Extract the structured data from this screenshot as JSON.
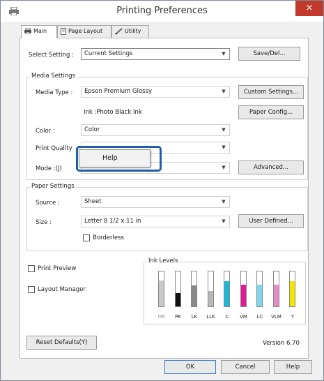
{
  "window": {
    "title": "Printing Preferences",
    "close_glyph": "×"
  },
  "tabs": [
    {
      "label": "Main",
      "icon": "printer-icon"
    },
    {
      "label": "Page Layout",
      "icon": "page-icon"
    },
    {
      "label": "Utility",
      "icon": "pencil-icon"
    }
  ],
  "select_setting": {
    "label": "Select Setting :",
    "value": "Current Settings",
    "button": "Save/Del..."
  },
  "media_settings": {
    "title": "Media Settings",
    "media_type_label": "Media Type :",
    "media_type_value": "Epson Premium Glossy",
    "custom_settings_button": "Custom Settings...",
    "ink_text": "Ink :Photo Black Ink",
    "paper_config_button": "Paper Config...",
    "color_label": "Color :",
    "color_value": "Color",
    "print_quality_label": "Print Quality",
    "print_quality_value": "",
    "mode_label": "Mode :(J)",
    "mode_value": "",
    "advanced_button": "Advanced..."
  },
  "context_menu": {
    "item": "Help"
  },
  "paper_settings": {
    "title": "Paper Settings",
    "source_label": "Source :",
    "source_value": "Sheet",
    "size_label": "Size :",
    "size_value": "Letter 8 1/2 x 11 in",
    "user_defined_button": "User Defined...",
    "borderless_label": "Borderless",
    "borderless_checked": false
  },
  "print_preview": {
    "label": "Print Preview",
    "checked": false
  },
  "layout_manager": {
    "label": "Layout Manager",
    "checked": false
  },
  "ink_levels": {
    "title": "Ink Levels",
    "inks": [
      {
        "name": "MK",
        "color": "#c8c8c8",
        "level": 0.75,
        "dim": true
      },
      {
        "name": "PK",
        "color": "#111111",
        "level": 0.38,
        "dim": false
      },
      {
        "name": "LK",
        "color": "#8a8a8a",
        "level": 0.6,
        "dim": false
      },
      {
        "name": "LLK",
        "color": "#b8b8b8",
        "level": 0.45,
        "dim": false
      },
      {
        "name": "C",
        "color": "#19b8d6",
        "level": 0.72,
        "dim": false
      },
      {
        "name": "VM",
        "color": "#e0199a",
        "level": 0.62,
        "dim": false
      },
      {
        "name": "LC",
        "color": "#7fd6ef",
        "level": 0.62,
        "dim": false
      },
      {
        "name": "VLM",
        "color": "#e88ac8",
        "level": 0.62,
        "dim": false
      },
      {
        "name": "Y",
        "color": "#f2e600",
        "level": 0.72,
        "dim": false
      }
    ]
  },
  "footer": {
    "reset_button": "Reset Defaults(Y)",
    "version": "Version 6.70",
    "ok_button": "OK",
    "cancel_button": "Cancel",
    "help_button": "Help"
  },
  "colors": {
    "accent": "#1f5fa7",
    "close": "#c0392b"
  }
}
